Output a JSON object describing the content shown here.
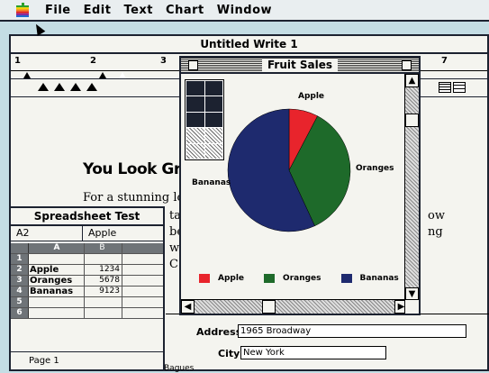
{
  "menubar": {
    "items": [
      "File",
      "Edit",
      "Text",
      "Chart",
      "Window"
    ]
  },
  "write_window": {
    "title": "Untitled Write 1",
    "ruler_numbers": [
      "1",
      "2",
      "3",
      "7"
    ],
    "heading": "You Look Gr",
    "body_lines": [
      "For a stunning loo",
      "ta",
      "be",
      "w",
      "C"
    ],
    "body_right_lines": [
      "ow",
      "ng"
    ],
    "form": {
      "address_label": "Address",
      "address_value": "1965 Broadway",
      "city_label": "City",
      "city_value": "New York",
      "partial_label": "Bagues"
    }
  },
  "spreadsheet": {
    "title": "Spreadsheet Test",
    "cell_ref": "A2",
    "cell_value": "Apple",
    "col_headers": [
      "A",
      "B",
      ""
    ],
    "rows": [
      {
        "num": "1",
        "a": "",
        "b": ""
      },
      {
        "num": "2",
        "a": "Apple",
        "b": "1234"
      },
      {
        "num": "3",
        "a": "Oranges",
        "b": "5678"
      },
      {
        "num": "4",
        "a": "Bananas",
        "b": "9123"
      },
      {
        "num": "5",
        "a": "",
        "b": ""
      },
      {
        "num": "6",
        "a": "",
        "b": ""
      }
    ],
    "page_label": "Page 1"
  },
  "chart_window": {
    "title": "Fruit Sales"
  },
  "chart_data": {
    "type": "pie",
    "categories": [
      "Apple",
      "Oranges",
      "Bananas"
    ],
    "values": [
      1234,
      5678,
      9123
    ],
    "colors": [
      "#e8242c",
      "#1e6a2a",
      "#1e2a6e"
    ],
    "legend_position": "bottom"
  },
  "colors": {
    "desktop": "#c4dde4",
    "window_bg": "#f4f4ef",
    "frame": "#1c2230"
  }
}
